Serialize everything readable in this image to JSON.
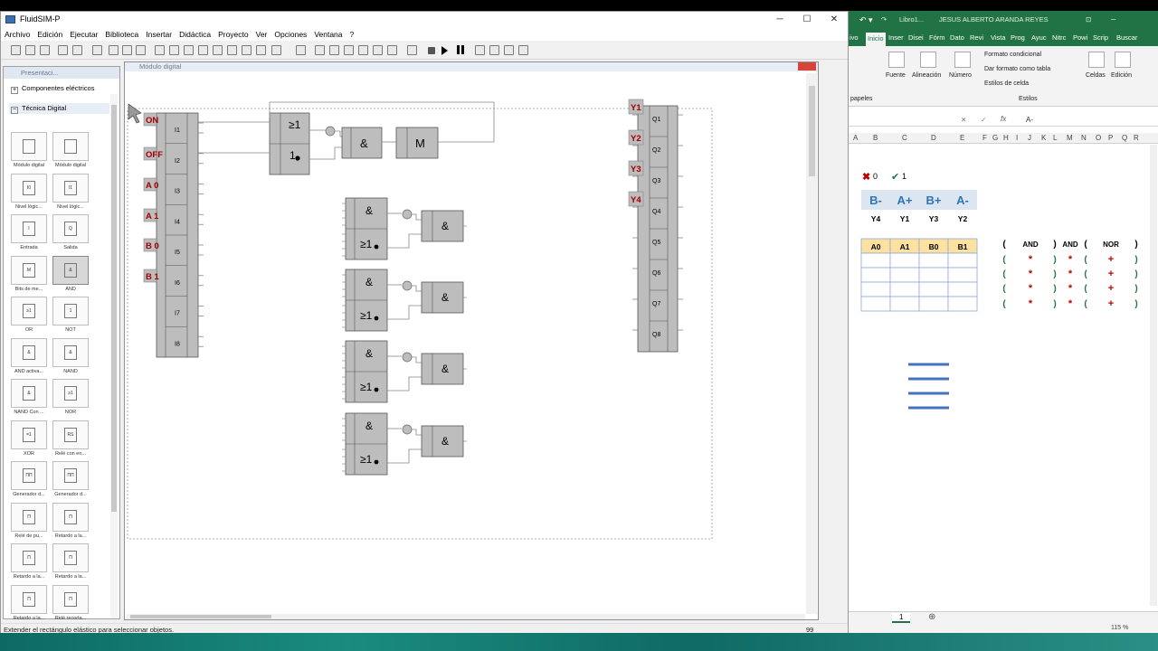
{
  "fluidsim": {
    "title": "FluidSIM-P",
    "menu": [
      "Archivo",
      "Edición",
      "Ejecutar",
      "Biblioteca",
      "Insertar",
      "Didáctica",
      "Proyecto",
      "Ver",
      "Opciones",
      "Ventana",
      "?"
    ],
    "window_buttons": {
      "minimize": "─",
      "maximize": "☐",
      "close": "✕"
    },
    "library": {
      "title": "Presentaci...",
      "categories": [
        {
          "label": "Componentes eléctricos",
          "toggle": "+"
        },
        {
          "label": "Técnica Digital",
          "toggle": "−"
        }
      ],
      "components": [
        {
          "label": "Módulo digital",
          "sym": ""
        },
        {
          "label": "Módulo digital",
          "sym": ""
        },
        {
          "label": "Nivel lógic...",
          "sym": "I0"
        },
        {
          "label": "Nivel lógic...",
          "sym": "I1"
        },
        {
          "label": "Entrada",
          "sym": "I"
        },
        {
          "label": "Salida",
          "sym": "Q"
        },
        {
          "label": "Bits de me...",
          "sym": "M"
        },
        {
          "label": "AND",
          "sym": "&"
        },
        {
          "label": "OR",
          "sym": "≥1"
        },
        {
          "label": "NOT",
          "sym": "1"
        },
        {
          "label": "AND activa...",
          "sym": "&"
        },
        {
          "label": "NAND",
          "sym": "&"
        },
        {
          "label": "NAND Con ...",
          "sym": "&"
        },
        {
          "label": "NOR",
          "sym": "≥1"
        },
        {
          "label": "XOR",
          "sym": "=1"
        },
        {
          "label": "Relé con en...",
          "sym": "RS"
        },
        {
          "label": "Generador d...",
          "sym": "ΠΠ"
        },
        {
          "label": "Generador d...",
          "sym": "ΠΠ"
        },
        {
          "label": "Relé de pu...",
          "sym": "Π"
        },
        {
          "label": "Retardo a la...",
          "sym": "Π"
        },
        {
          "label": "Retardo a la...",
          "sym": "Π"
        },
        {
          "label": "Retardo a la...",
          "sym": "Π"
        },
        {
          "label": "Retardo a la...",
          "sym": "Π"
        },
        {
          "label": "Relé recorta...",
          "sym": "Π"
        }
      ]
    },
    "document": {
      "title": "Módulo digital",
      "inputs": [
        "I1",
        "I2",
        "I3",
        "I4",
        "I5",
        "I6",
        "I7",
        "I8"
      ],
      "outputs": [
        "Q1",
        "Q2",
        "Q3",
        "Q4",
        "Q5",
        "Q6",
        "Q7",
        "Q8"
      ],
      "input_labels": [
        "ON",
        "OFF",
        "A 0",
        "A 1",
        "B 0",
        "B 1"
      ],
      "output_labels": [
        "Y1",
        "Y2",
        "Y3",
        "Y4"
      ],
      "gate_and": "&",
      "gate_or": "≥1",
      "gate_not": "1",
      "memory": "M"
    },
    "status": {
      "text": "Extender el rectángulo elástico para seleccionar objetos.",
      "zoom": "99"
    }
  },
  "excel": {
    "title_file": "Libro1...",
    "user": "JESUS ALBERTO ARANDA REYES",
    "tabs": [
      "ivo",
      "Inicio",
      "Inser",
      "Disei",
      "Fórm",
      "Dato",
      "Revi",
      "Vista",
      "Prog",
      "Ayuc",
      "Nitrc",
      "Powi",
      "Scrip",
      "Buscar"
    ],
    "ribbon": {
      "formato_condicional": "Formato condicional",
      "dar_formato": "Dar formato como tabla",
      "estilos_celda": "Estilos de celda",
      "estilos": "Estilos",
      "fuente": "Fuente",
      "alineacion": "Alineación",
      "numero": "Número",
      "celdas": "Celdas",
      "edicion": "Edición",
      "portapapeles": "papeles"
    },
    "formula": "A-",
    "columns": [
      "A",
      "B",
      "C",
      "D",
      "E",
      "F",
      "G",
      "H",
      "I",
      "J",
      "K",
      "L",
      "M",
      "N",
      "O",
      "P",
      "Q",
      "R"
    ],
    "errors": {
      "x_count": "0",
      "check_count": "1"
    },
    "sequence": [
      "B-",
      "A+",
      "B+",
      "A-"
    ],
    "sequence_outputs": [
      "Y4",
      "Y1",
      "Y3",
      "Y2"
    ],
    "table_headers": [
      "A0",
      "A1",
      "B0",
      "B1"
    ],
    "logic_headers": [
      "(",
      "AND",
      ")",
      "AND",
      "(",
      "NOR",
      ")"
    ],
    "logic_rows": [
      [
        "(",
        "*",
        ")",
        "*",
        "(",
        "+",
        ")"
      ],
      [
        "(",
        "*",
        ")",
        "*",
        "(",
        "+",
        ")"
      ],
      [
        "(",
        "*",
        ")",
        "*",
        "(",
        "+",
        ")"
      ],
      [
        "(",
        "*",
        ")",
        "*",
        "(",
        "+",
        ")"
      ]
    ],
    "sheet_tab": "1",
    "zoom": "115 %",
    "colors": {
      "green": "#217346",
      "header_fill": "#fde1a0",
      "seq_fill": "#dce6f1",
      "seq_text": "#2e75b6",
      "red": "#c00000"
    }
  }
}
